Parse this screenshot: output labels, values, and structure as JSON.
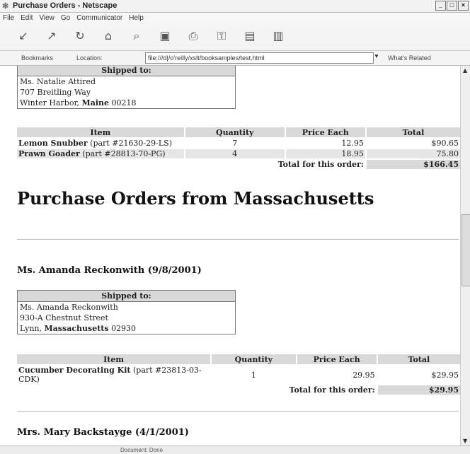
{
  "window": {
    "title": "Purchase Orders - Netscape",
    "buttons": [
      "_",
      "□",
      "×"
    ]
  },
  "menu": [
    "File",
    "Edit",
    "View",
    "Go",
    "Communicator",
    "Help"
  ],
  "toolbar_icons": [
    "back-icon",
    "forward-icon",
    "reload-icon",
    "home-icon",
    "search-icon",
    "netscape-icon",
    "print-icon",
    "security-icon",
    "shop-icon",
    "stop-icon"
  ],
  "location": {
    "bookmarks_label": "Bookmarks",
    "location_label": "Location:",
    "url": "file:///d|/o'reilly/xslt/booksamples/test.html",
    "related_label": "What's Related"
  },
  "order1": {
    "shipped_to_header": "Shipped to:",
    "ship_name": "Ms. Natalie Attired",
    "ship_street": "707 Breitling Way",
    "ship_city": "Winter Harbor,",
    "ship_state": "Maine",
    "ship_zip": "00218",
    "columns": [
      "Item",
      "Quantity",
      "Price Each",
      "Total"
    ],
    "rows": [
      {
        "name": "Lemon Snubber",
        "part": "(part #21630-29-LS)",
        "qty": "7",
        "price": "12.95",
        "total": "$90.65"
      },
      {
        "name": "Prawn Goader",
        "part": "(part #28813-70-PG)",
        "qty": "4",
        "price": "18.95",
        "total": "75.80"
      }
    ],
    "total_label": "Total for this order:",
    "total_value": "$166.45"
  },
  "state_heading": "Purchase Orders from Massachusetts",
  "order2": {
    "heading": "Ms. Amanda Reckonwith (9/8/2001)",
    "shipped_to_header": "Shipped to:",
    "ship_name": "Ms. Amanda Reckonwith",
    "ship_street": "930-A Chestnut Street",
    "ship_city": "Lynn,",
    "ship_state": "Massachusetts",
    "ship_zip": "02930",
    "columns": [
      "Item",
      "Quantity",
      "Price Each",
      "Total"
    ],
    "rows": [
      {
        "name": "Cucumber Decorating Kit",
        "part": "(part #23813-03-CDK)",
        "qty": "1",
        "price": "29.95",
        "total": "$29.95"
      }
    ],
    "total_label": "Total for this order:",
    "total_value": "$29.95"
  },
  "order3": {
    "heading": "Mrs. Mary Backstayge (4/1/2001)"
  },
  "status": {
    "text": "Document: Done"
  }
}
